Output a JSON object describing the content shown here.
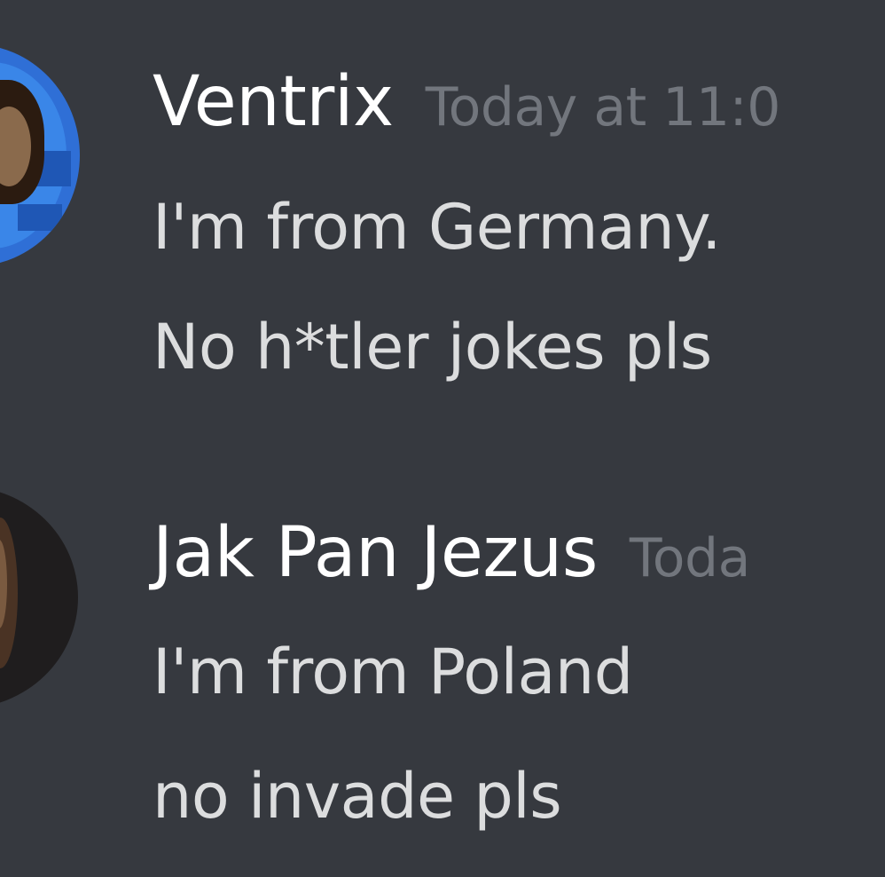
{
  "messages": [
    {
      "username": "Ventrix",
      "timestamp": "Today at 11:0",
      "lines": [
        "I'm from Germany.",
        "No h*tler jokes pls"
      ],
      "avatar_icon": "user-avatar-icon",
      "avatar_color": "#2f6fd6"
    },
    {
      "username": "Jak Pan Jezus",
      "timestamp": "Toda",
      "lines": [
        "I'm from Poland",
        "no invade pls"
      ],
      "avatar_icon": "user-avatar-icon",
      "avatar_color": "#1f1d1e"
    }
  ],
  "colors": {
    "background": "#36393f",
    "username": "#ffffff",
    "timestamp": "#72767d",
    "message_text": "#dcddde"
  }
}
